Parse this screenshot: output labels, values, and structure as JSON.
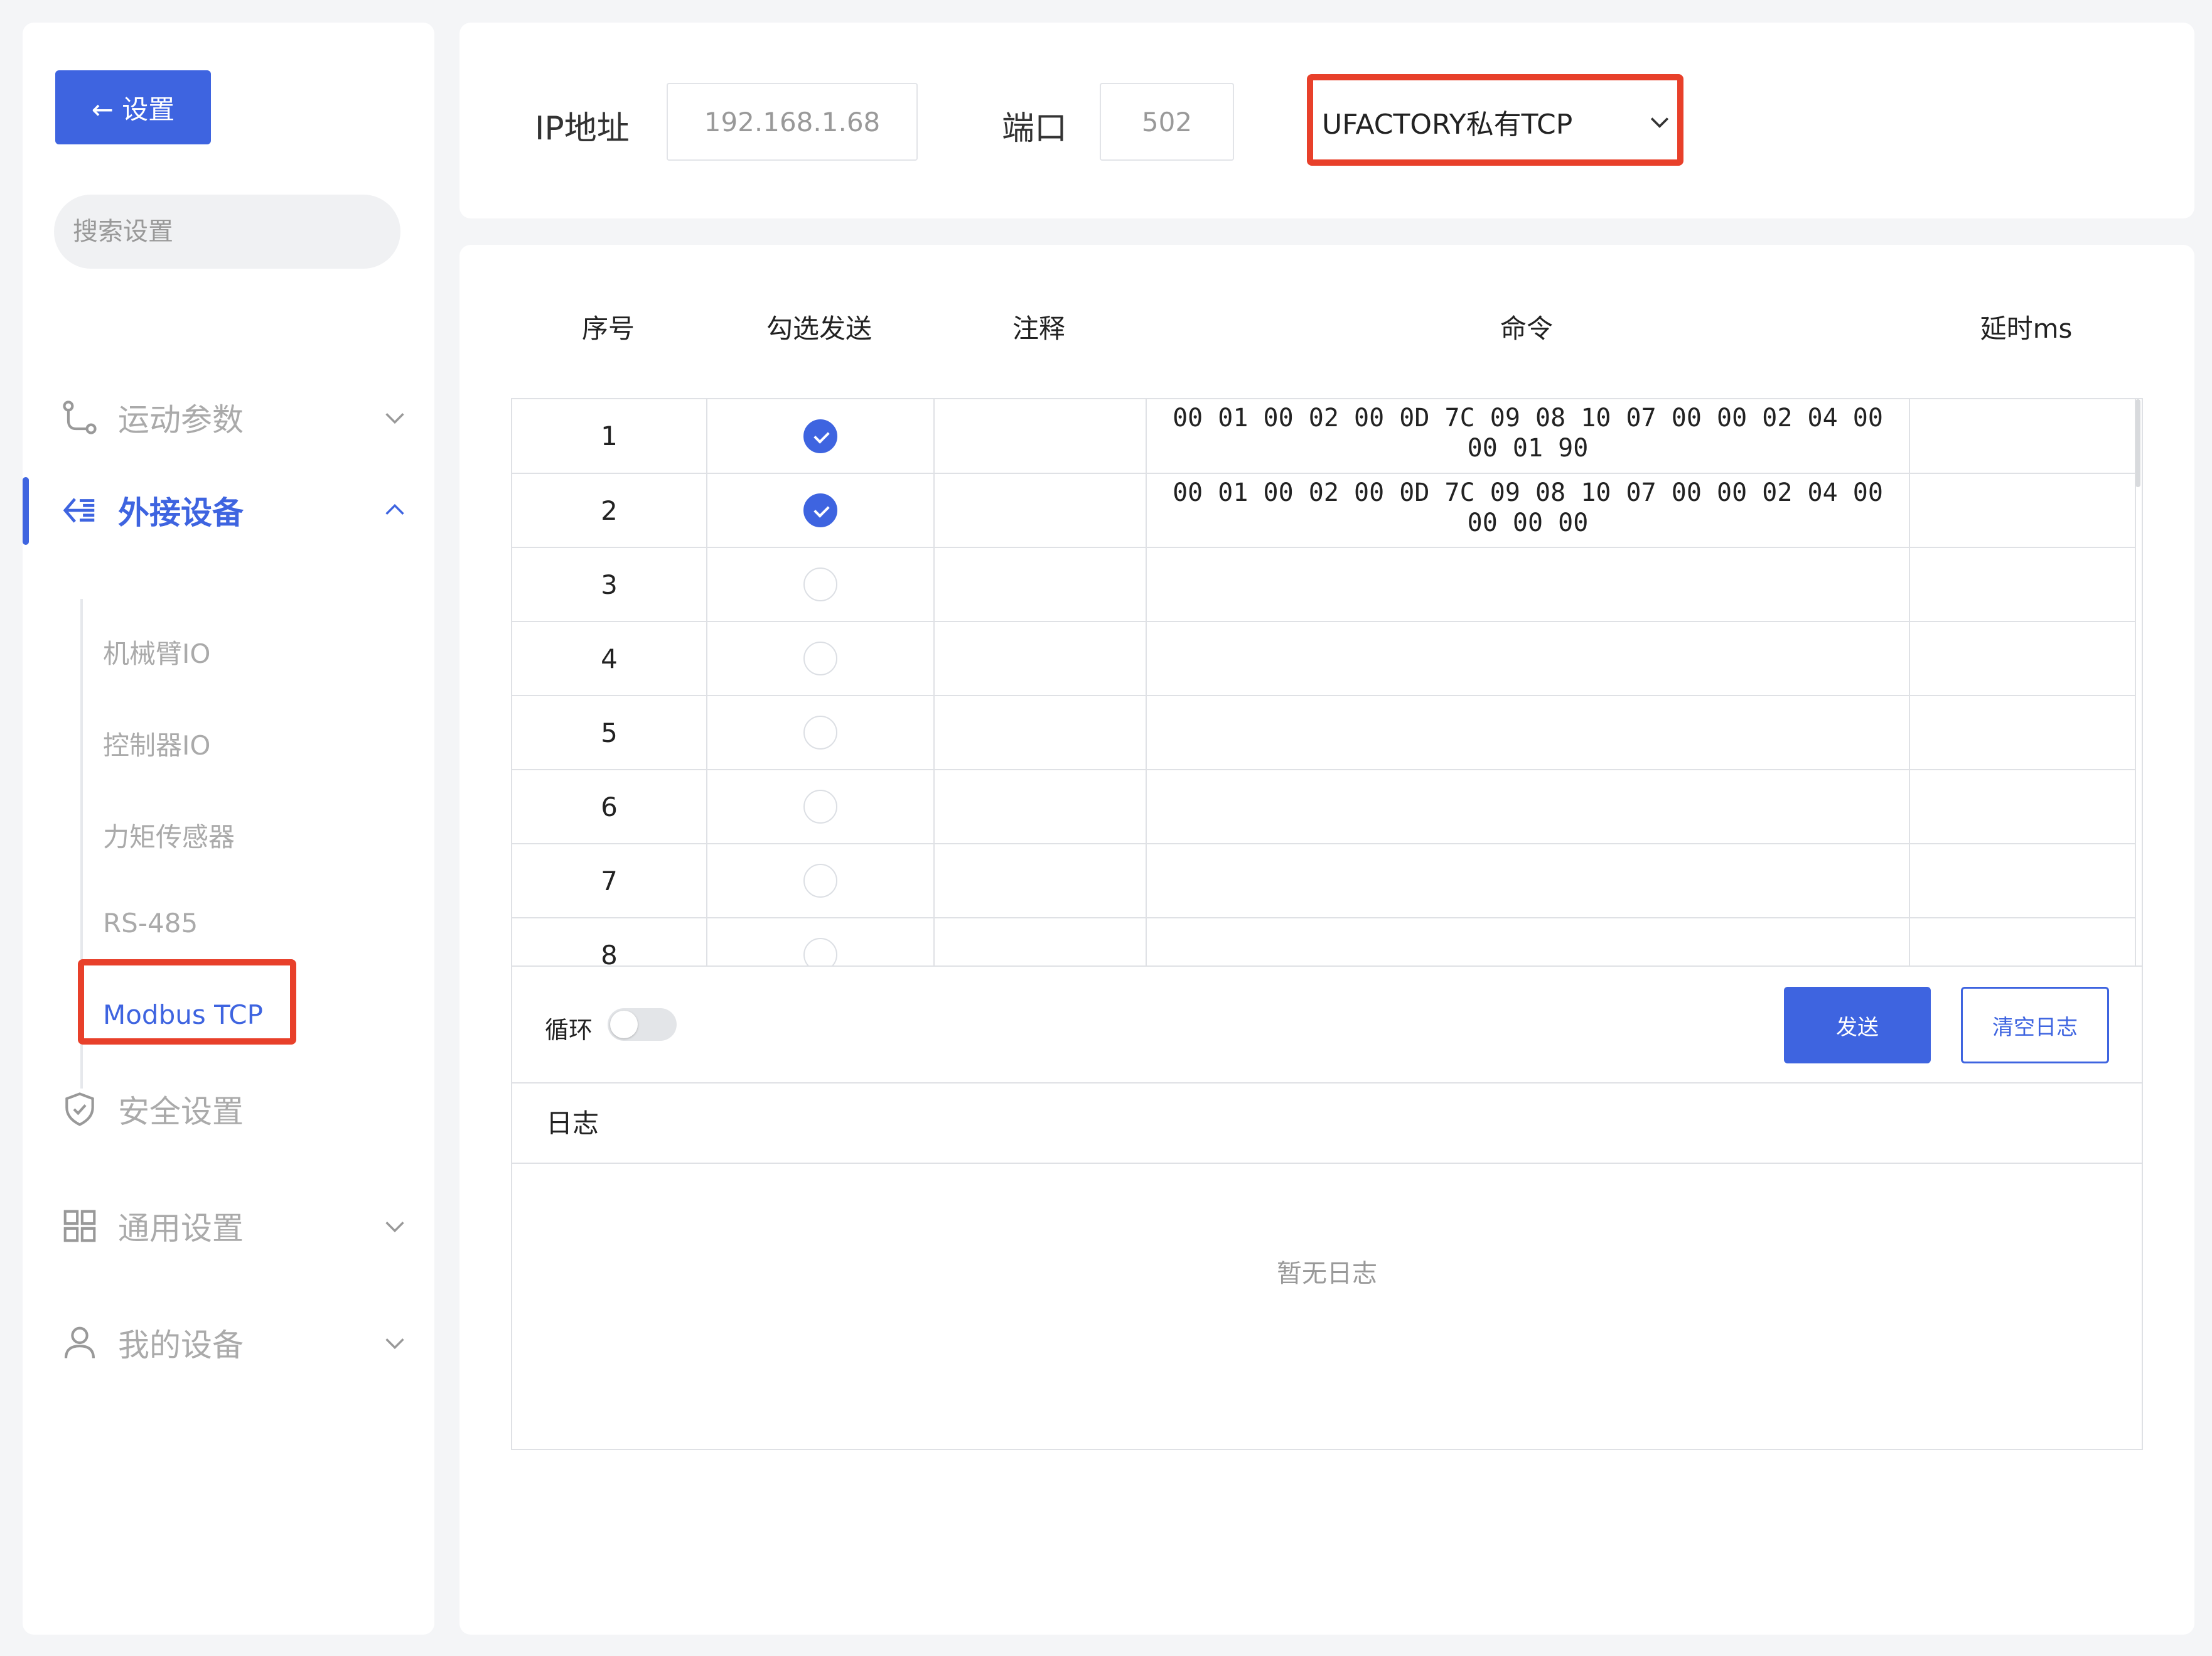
{
  "sidebar": {
    "back_label": "← 设置",
    "search_placeholder": "搜索设置",
    "nav": {
      "motion": "运动参数",
      "external": "外接设备",
      "safety": "安全设置",
      "general": "通用设置",
      "my_device": "我的设备"
    },
    "sub_items": [
      "机械臂IO",
      "控制器IO",
      "力矩传感器",
      "RS-485",
      "Modbus TCP"
    ]
  },
  "topbar": {
    "ip_label": "IP地址",
    "ip_value": "192.168.1.68",
    "port_label": "端口",
    "port_value": "502",
    "protocol": "UFACTORY私有TCP"
  },
  "table": {
    "headers": {
      "index": "序号",
      "check": "勾选发送",
      "note": "注释",
      "command": "命令",
      "delay": "延时ms"
    },
    "rows": [
      {
        "index": "1",
        "checked": true,
        "note": "",
        "command": "00 01 00 02 00 0D 7C 09 08 10 07 00 00 02 04 00\n00 01 90",
        "delay": ""
      },
      {
        "index": "2",
        "checked": true,
        "note": "",
        "command": "00 01 00 02 00 0D 7C 09 08 10 07 00 00 02 04 00\n00 00 00",
        "delay": ""
      },
      {
        "index": "3",
        "checked": false,
        "note": "",
        "command": "",
        "delay": ""
      },
      {
        "index": "4",
        "checked": false,
        "note": "",
        "command": "",
        "delay": ""
      },
      {
        "index": "5",
        "checked": false,
        "note": "",
        "command": "",
        "delay": ""
      },
      {
        "index": "6",
        "checked": false,
        "note": "",
        "command": "",
        "delay": ""
      },
      {
        "index": "7",
        "checked": false,
        "note": "",
        "command": "",
        "delay": ""
      },
      {
        "index": "8",
        "checked": false,
        "note": "",
        "command": "",
        "delay": ""
      }
    ]
  },
  "controls": {
    "loop_label": "循环",
    "loop_on": false,
    "send_label": "发送",
    "clear_label": "清空日志"
  },
  "log": {
    "title": "日志",
    "empty_text": "暂无日志"
  },
  "colors": {
    "accent": "#3e64e0",
    "highlight": "#e8402a"
  }
}
